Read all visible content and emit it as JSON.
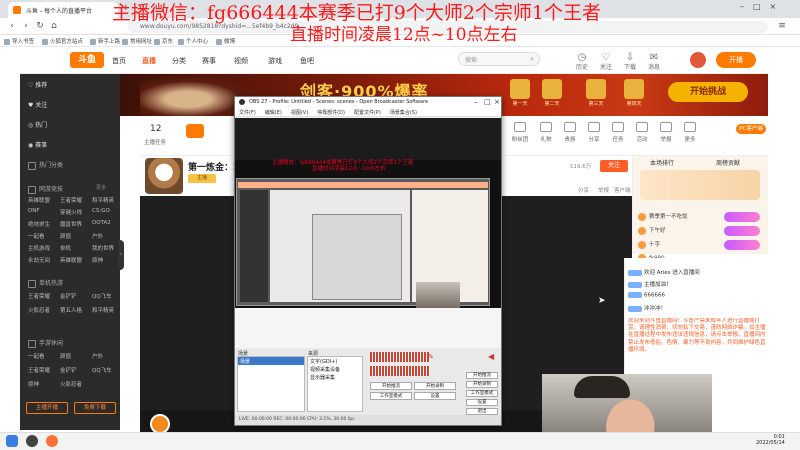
{
  "overlay": {
    "line1": "主播微信：fg666444本赛季已打9个大师2个宗师1个王者",
    "line2": "直播时间凌晨12点~10点左右"
  },
  "browser": {
    "tab_title": "斗鱼 - 每个人的直播平台",
    "url": "www.douyu.com/9852818?dyshid=...5ef4b9_b4c2d9...",
    "bookmarks": [
      "导入书签",
      "火狐官方站点",
      "新手上路",
      "常用网址",
      "京东",
      "个人中心",
      "微博"
    ]
  },
  "site": {
    "logo": "斗鱼",
    "nav": [
      "首页",
      "直播",
      "分类",
      "赛事",
      "视频",
      "游戏",
      "鱼吧"
    ],
    "search_placeholder": "搜索",
    "header_icons": [
      "历史",
      "关注",
      "下载",
      "消息"
    ],
    "open_live": "开播"
  },
  "sidebar": {
    "items": [
      "推荐",
      "关注",
      "热门",
      "赛事"
    ],
    "sections": [
      "热门分类",
      "网游竞技",
      "单机热游",
      "手游休闲"
    ],
    "categories": [
      [
        "英雄联盟",
        "王者荣耀",
        "和平精英"
      ],
      [
        "DNF",
        "穿越火线",
        "CS:GO"
      ],
      [
        "绝地求生",
        "魔兽世界",
        "DOTA2"
      ],
      [
        "一起看",
        "颜值",
        "户外"
      ],
      [
        "主机游戏",
        "单机",
        "我的世界"
      ],
      [
        "永劫无间",
        "英雄联盟",
        "原神"
      ],
      [
        "王者荣耀",
        "金铲铲",
        "QQ飞车"
      ],
      [
        "火影忍者",
        "第五人格",
        "和平精英"
      ]
    ],
    "more": "更多",
    "btn_left": "主播开播",
    "btn_right": "免费下载"
  },
  "banner": {
    "title": "剑客·900%爆率",
    "button": "开始挑战",
    "prizes": [
      "第一天",
      "第二天",
      "第三天",
      "第四天"
    ]
  },
  "info": {
    "fav_count": "12",
    "fav_label": "主播任务",
    "tools": [
      "粉丝团",
      "礼物",
      "贵族",
      "分享",
      "任务",
      "活动",
      "举报",
      "更多"
    ],
    "report_btn": "PC客户端"
  },
  "room": {
    "title": "第一炼金：2星",
    "tag": "主播",
    "count": "119.6万",
    "follow": "关注",
    "actions": [
      "分享",
      "举报",
      "客户端"
    ]
  },
  "obs": {
    "title": "OBS 27 - Profile: Untitled - Scenes: scenes - Open Broadcaster Software",
    "menu": [
      "文件(F)",
      "编辑(E)",
      "视图(V)",
      "停靠部件(D)",
      "配置文件(P)",
      "场景集合(S)",
      "工具(T)",
      "帮助(H)"
    ],
    "overlay_text1": "主播微信：fg666444本赛季已打9个大师2个宗师1个王者",
    "overlay_text2": "直播时间凌晨12点~10点左右",
    "scenes_title": "场景",
    "scene_item": "场景",
    "sources_title": "来源",
    "sources": [
      "文字(GDI+)",
      "视频采集设备",
      "显示器采集"
    ],
    "ctrl_buttons": [
      "开始推流",
      "开始录制",
      "工作室模式",
      "设置",
      "退出"
    ],
    "status": "LIVE: 00:00:00  REC: 00:00:00  CPU: 3.1%, 30.00 fps"
  },
  "rank": {
    "tabs": [
      "本场排行",
      "周榜贡献"
    ],
    "rows": [
      "赛季第一不吃饭",
      "下午好",
      "十字",
      "fk990"
    ]
  },
  "chat": {
    "lines": [
      "欢迎 Aries 进入直播间",
      "主播加油！",
      "666666",
      "冲冲冲！",
      "一起加油哈哈哈"
    ],
    "notice": "欢迎来到斗鱼直播间！斗鱼严禁未成年人进行直播或打赏，请理性消费，切勿私下交易，谨防网络诈骗。如主播在直播过程中发布违法违规信息，请点击举报。直播间内禁止发布低俗、色情、暴力等不良内容，共同维护绿色直播环境。"
  },
  "taskbar": {
    "time": "0:01",
    "date": "2022/05/14"
  }
}
